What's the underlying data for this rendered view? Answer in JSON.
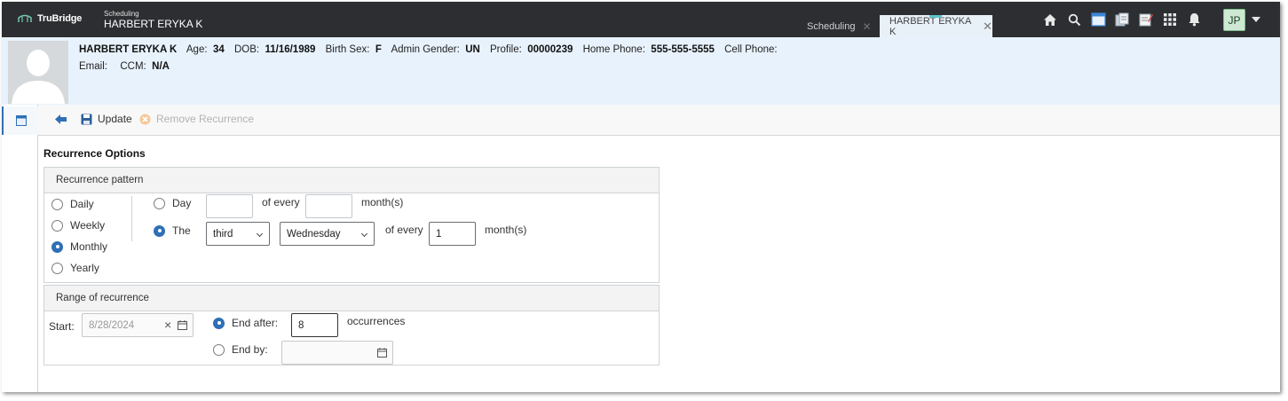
{
  "app": {
    "brand": "TruBridge",
    "module_small": "Scheduling",
    "patient_header": "HARBERT ERYKA K"
  },
  "tabs": [
    {
      "label": "Scheduling",
      "active": false
    },
    {
      "label": "HARBERT ERYKA K",
      "active": true
    }
  ],
  "top_icons": [
    "home-icon",
    "search-icon",
    "calendar-icon",
    "documents-icon",
    "notes-icon",
    "apps-grid-icon",
    "bell-icon"
  ],
  "user": {
    "initials": "JP"
  },
  "patient": {
    "name": "HARBERT ERYKA K",
    "age_label": "Age:",
    "age": "34",
    "dob_label": "DOB:",
    "dob": "11/16/1989",
    "birth_sex_label": "Birth Sex:",
    "birth_sex": "F",
    "admin_gender_label": "Admin Gender:",
    "admin_gender": "UN",
    "profile_label": "Profile:",
    "profile": "00000239",
    "home_phone_label": "Home Phone:",
    "home_phone": "555-555-5555",
    "cell_phone_label": "Cell Phone:",
    "cell_phone": "",
    "email_label": "Email:",
    "email": "",
    "ccm_label": "CCM:",
    "ccm": "N/A"
  },
  "toolbar": {
    "update_label": "Update",
    "remove_label": "Remove Recurrence"
  },
  "recurrence": {
    "title": "Recurrence Options",
    "pattern_title": "Recurrence pattern",
    "frequency_options": [
      "Daily",
      "Weekly",
      "Monthly",
      "Yearly"
    ],
    "frequency_selected": "Monthly",
    "day_option_label": "Day",
    "day_value": "",
    "of_every_label": "of every",
    "day_months_value": "",
    "months_label": "month(s)",
    "the_option_label": "The",
    "ordinal_selected": "third",
    "weekday_selected": "Wednesday",
    "the_months_value": "1",
    "monthly_mode_selected": "The"
  },
  "range": {
    "title": "Range of recurrence",
    "start_label": "Start:",
    "start_value": "8/28/2024",
    "end_after_label": "End after:",
    "end_after_value": "8",
    "occurrences_label": "occurrences",
    "end_by_label": "End by:",
    "end_by_value": "",
    "end_selected": "End after"
  },
  "colors": {
    "topbar": "#2c2e31",
    "banner": "#e8f2fc",
    "accent": "#2f6fb5",
    "avatar_bg": "#cfe8d4"
  }
}
